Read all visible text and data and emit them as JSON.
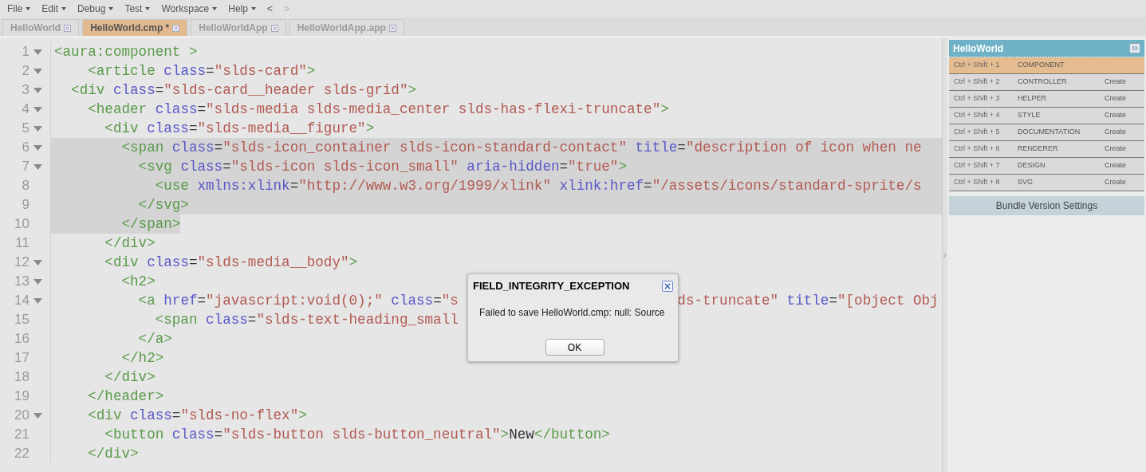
{
  "menu": [
    {
      "label": "File",
      "caret": true
    },
    {
      "label": "Edit",
      "caret": true
    },
    {
      "label": "Debug",
      "caret": true
    },
    {
      "label": "Test",
      "caret": true
    },
    {
      "label": "Workspace",
      "caret": true
    },
    {
      "label": "Help",
      "caret": true
    },
    {
      "label": "<",
      "caret": false,
      "disabled": false
    },
    {
      "label": ">",
      "caret": false,
      "disabled": true
    }
  ],
  "tabs": [
    {
      "label": "HelloWorld",
      "selected": false
    },
    {
      "label": "HelloWorld.cmp *",
      "selected": true
    },
    {
      "label": "HelloWorldApp",
      "selected": false
    },
    {
      "label": "HelloWorldApp.app",
      "selected": false
    }
  ],
  "editor": {
    "lines": [
      {
        "number": "1",
        "fold": true,
        "selected": false,
        "segments": [
          [
            {
              "kind": "tag",
              "text": "<aura:component >"
            }
          ]
        ]
      },
      {
        "number": "2",
        "fold": true,
        "selected": false,
        "segments": [
          [
            {
              "kind": "tag",
              "text": "    <article "
            },
            {
              "kind": "attr",
              "text": "class"
            },
            {
              "kind": "plain",
              "text": "="
            },
            {
              "kind": "str",
              "text": "\"slds-card\""
            },
            {
              "kind": "tag",
              "text": ">"
            }
          ]
        ]
      },
      {
        "number": "3",
        "fold": true,
        "selected": false,
        "segments": [
          [
            {
              "kind": "tag",
              "text": "  <div "
            },
            {
              "kind": "attr",
              "text": "class"
            },
            {
              "kind": "plain",
              "text": "="
            },
            {
              "kind": "str",
              "text": "\"slds-card__header slds-grid\""
            },
            {
              "kind": "tag",
              "text": ">"
            }
          ]
        ]
      },
      {
        "number": "4",
        "fold": true,
        "selected": false,
        "segments": [
          [
            {
              "kind": "tag",
              "text": "    <header "
            },
            {
              "kind": "attr",
              "text": "class"
            },
            {
              "kind": "plain",
              "text": "="
            },
            {
              "kind": "str",
              "text": "\"slds-media slds-media_center slds-has-flexi-truncate\""
            },
            {
              "kind": "tag",
              "text": ">"
            }
          ]
        ]
      },
      {
        "number": "5",
        "fold": true,
        "selected": false,
        "segments": [
          [
            {
              "kind": "tag",
              "text": "      <div "
            },
            {
              "kind": "attr",
              "text": "class"
            },
            {
              "kind": "plain",
              "text": "="
            },
            {
              "kind": "str",
              "text": "\"slds-media__figure\""
            },
            {
              "kind": "tag",
              "text": ">"
            }
          ]
        ]
      },
      {
        "number": "6",
        "fold": true,
        "selected": true,
        "segments": [
          [
            {
              "kind": "tag",
              "text": "        <span "
            },
            {
              "kind": "attr",
              "text": "class"
            },
            {
              "kind": "plain",
              "text": "="
            },
            {
              "kind": "str",
              "text": "\"slds-icon_container slds-icon-standard-contact\" "
            },
            {
              "kind": "attr",
              "text": "title"
            },
            {
              "kind": "plain",
              "text": "="
            },
            {
              "kind": "str",
              "text": "\"description of icon when ne"
            }
          ]
        ]
      },
      {
        "number": "7",
        "fold": true,
        "selected": true,
        "segments": [
          [
            {
              "kind": "tag",
              "text": "          <svg "
            },
            {
              "kind": "attr",
              "text": "class"
            },
            {
              "kind": "plain",
              "text": "="
            },
            {
              "kind": "str",
              "text": "\"slds-icon slds-icon_small\" "
            },
            {
              "kind": "attr",
              "text": "aria-hidden"
            },
            {
              "kind": "plain",
              "text": "="
            },
            {
              "kind": "str",
              "text": "\"true\""
            },
            {
              "kind": "tag",
              "text": ">"
            }
          ]
        ]
      },
      {
        "number": "8",
        "fold": false,
        "selected": true,
        "segments": [
          [
            {
              "kind": "tag",
              "text": "            <use "
            },
            {
              "kind": "attr",
              "text": "xmlns:xlink"
            },
            {
              "kind": "plain",
              "text": "="
            },
            {
              "kind": "str",
              "text": "\"http://www.w3.org/1999/xlink\" "
            },
            {
              "kind": "attr",
              "text": "xlink:href"
            },
            {
              "kind": "plain",
              "text": "="
            },
            {
              "kind": "str",
              "text": "\"/assets/icons/standard-sprite/s"
            }
          ]
        ]
      },
      {
        "number": "9",
        "fold": false,
        "selected": true,
        "segments": [
          [
            {
              "kind": "tag",
              "text": "          </svg>"
            }
          ]
        ]
      },
      {
        "number": "10",
        "fold": false,
        "selected": true,
        "segments": [
          [
            {
              "kind": "tag",
              "text": "        </span>"
            }
          ]
        ]
      },
      {
        "number": "11",
        "fold": false,
        "selected": false,
        "segments": [
          [
            {
              "kind": "tag",
              "text": "      </div>"
            }
          ]
        ]
      },
      {
        "number": "12",
        "fold": true,
        "selected": false,
        "segments": [
          [
            {
              "kind": "tag",
              "text": "      <div "
            },
            {
              "kind": "attr",
              "text": "class"
            },
            {
              "kind": "plain",
              "text": "="
            },
            {
              "kind": "str",
              "text": "\"slds-media__body\""
            },
            {
              "kind": "tag",
              "text": ">"
            }
          ]
        ]
      },
      {
        "number": "13",
        "fold": true,
        "selected": false,
        "segments": [
          [
            {
              "kind": "tag",
              "text": "        <h2>"
            }
          ]
        ]
      },
      {
        "number": "14",
        "fold": true,
        "selected": false,
        "segments": [
          [
            {
              "kind": "tag",
              "text": "          <a "
            },
            {
              "kind": "attr",
              "text": "href"
            },
            {
              "kind": "plain",
              "text": "="
            },
            {
              "kind": "str",
              "text": "\"javascript:void(0);\" "
            },
            {
              "kind": "attr",
              "text": "class"
            },
            {
              "kind": "plain",
              "text": "="
            },
            {
              "kind": "str",
              "text": "\"s"
            }
          ],
          [
            {
              "kind": "str",
              "text": "ds-truncate\" "
            },
            {
              "kind": "attr",
              "text": "title"
            },
            {
              "kind": "plain",
              "text": "="
            },
            {
              "kind": "str",
              "text": "\"[object Obj"
            }
          ]
        ]
      },
      {
        "number": "15",
        "fold": false,
        "selected": false,
        "segments": [
          [
            {
              "kind": "tag",
              "text": "            <span "
            },
            {
              "kind": "attr",
              "text": "class"
            },
            {
              "kind": "plain",
              "text": "="
            },
            {
              "kind": "str",
              "text": "\"slds-text-heading_small"
            }
          ]
        ]
      },
      {
        "number": "16",
        "fold": false,
        "selected": false,
        "segments": [
          [
            {
              "kind": "tag",
              "text": "          </a>"
            }
          ]
        ]
      },
      {
        "number": "17",
        "fold": false,
        "selected": false,
        "segments": [
          [
            {
              "kind": "tag",
              "text": "        </h2>"
            }
          ]
        ]
      },
      {
        "number": "18",
        "fold": false,
        "selected": false,
        "segments": [
          [
            {
              "kind": "tag",
              "text": "      </div>"
            }
          ]
        ]
      },
      {
        "number": "19",
        "fold": false,
        "selected": false,
        "segments": [
          [
            {
              "kind": "tag",
              "text": "    </header>"
            }
          ]
        ]
      },
      {
        "number": "20",
        "fold": true,
        "selected": false,
        "segments": [
          [
            {
              "kind": "tag",
              "text": "    <div "
            },
            {
              "kind": "attr",
              "text": "class"
            },
            {
              "kind": "plain",
              "text": "="
            },
            {
              "kind": "str",
              "text": "\"slds-no-flex\""
            },
            {
              "kind": "tag",
              "text": ">"
            }
          ]
        ]
      },
      {
        "number": "21",
        "fold": false,
        "selected": false,
        "segments": [
          [
            {
              "kind": "tag",
              "text": "      <button "
            },
            {
              "kind": "attr",
              "text": "class"
            },
            {
              "kind": "plain",
              "text": "="
            },
            {
              "kind": "str",
              "text": "\"slds-button slds-button_neutral\""
            },
            {
              "kind": "tag",
              "text": ">"
            },
            {
              "kind": "plain",
              "text": "New"
            },
            {
              "kind": "tag",
              "text": "</button>"
            }
          ]
        ]
      },
      {
        "number": "22",
        "fold": false,
        "selected": false,
        "segments": [
          [
            {
              "kind": "tag",
              "text": "    </div>"
            }
          ]
        ]
      }
    ]
  },
  "bundle": {
    "title": "HelloWorld",
    "items": [
      {
        "shortcut": "Ctrl + Shift + 1",
        "name": "COMPONENT",
        "selected": true
      },
      {
        "shortcut": "Ctrl + Shift + 2",
        "name": "CONTROLLER",
        "action": "Create",
        "selected": false
      },
      {
        "shortcut": "Ctrl + Shift + 3",
        "name": "HELPER",
        "action": "Create",
        "selected": false
      },
      {
        "shortcut": "Ctrl + Shift + 4",
        "name": "STYLE",
        "action": "Create",
        "selected": false
      },
      {
        "shortcut": "Ctrl + Shift + 5",
        "name": "DOCUMENTATION",
        "action": "Create",
        "selected": false
      },
      {
        "shortcut": "Ctrl + Shift + 6",
        "name": "RENDERER",
        "action": "Create",
        "selected": false
      },
      {
        "shortcut": "Ctrl + Shift + 7",
        "name": "DESIGN",
        "action": "Create",
        "selected": false
      },
      {
        "shortcut": "Ctrl + Shift + 8",
        "name": "SVG",
        "action": "Create",
        "selected": false
      }
    ],
    "settings": "Bundle Version Settings"
  },
  "dialog": {
    "title": "FIELD_INTEGRITY_EXCEPTION",
    "message": "Failed to save HelloWorld.cmp: null: Source",
    "button": "OK"
  }
}
